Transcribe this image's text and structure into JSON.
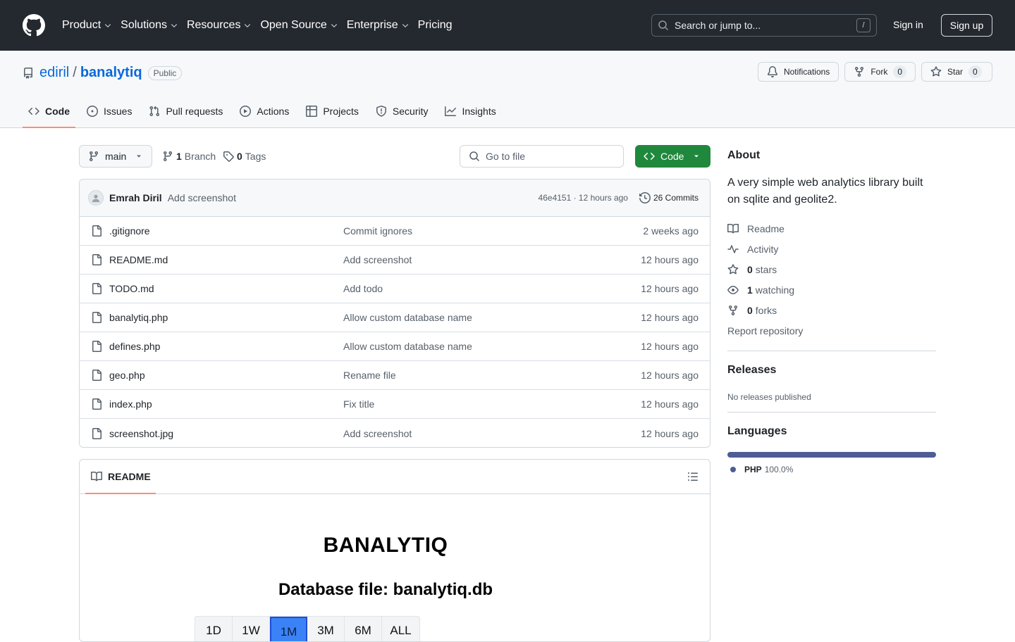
{
  "header": {
    "nav": [
      "Product",
      "Solutions",
      "Resources",
      "Open Source",
      "Enterprise",
      "Pricing"
    ],
    "search_placeholder": "Search or jump to...",
    "search_kbd": "/",
    "sign_in": "Sign in",
    "sign_up": "Sign up"
  },
  "repo": {
    "owner": "ediril",
    "separator": "/",
    "name": "banalytiq",
    "visibility": "Public",
    "actions": {
      "notifications": "Notifications",
      "fork": "Fork",
      "fork_count": "0",
      "star": "Star",
      "star_count": "0"
    },
    "tabs": [
      "Code",
      "Issues",
      "Pull requests",
      "Actions",
      "Projects",
      "Security",
      "Insights"
    ],
    "active_tab": "Code"
  },
  "toolbar": {
    "branch": "main",
    "branch_count": "1",
    "branch_label": "Branch",
    "tag_count": "0",
    "tag_label": "Tags",
    "go_to_file": "Go to file",
    "code_button": "Code"
  },
  "latest_commit": {
    "author": "Emrah Diril",
    "message": "Add screenshot",
    "hash_time": "46e4151 · 12 hours ago",
    "commits": "26 Commits"
  },
  "files": [
    {
      "name": ".gitignore",
      "message": "Commit ignores",
      "time": "2 weeks ago"
    },
    {
      "name": "README.md",
      "message": "Add screenshot",
      "time": "12 hours ago"
    },
    {
      "name": "TODO.md",
      "message": "Add todo",
      "time": "12 hours ago"
    },
    {
      "name": "banalytiq.php",
      "message": "Allow custom database name",
      "time": "12 hours ago"
    },
    {
      "name": "defines.php",
      "message": "Allow custom database name",
      "time": "12 hours ago"
    },
    {
      "name": "geo.php",
      "message": "Rename file",
      "time": "12 hours ago"
    },
    {
      "name": "index.php",
      "message": "Fix title",
      "time": "12 hours ago"
    },
    {
      "name": "screenshot.jpg",
      "message": "Add screenshot",
      "time": "12 hours ago"
    }
  ],
  "readme": {
    "tab_label": "README",
    "screenshot": {
      "title": "BANALYTIQ",
      "subtitle": "Database file: banalytiq.db",
      "ranges": [
        "1D",
        "1W",
        "1M",
        "3M",
        "6M",
        "ALL"
      ],
      "selected_range": "1M"
    }
  },
  "sidebar": {
    "about_title": "About",
    "description": "A very simple web analytics library built on sqlite and geolite2.",
    "links": {
      "readme": "Readme",
      "activity": "Activity",
      "stars_count": "0",
      "stars_label": "stars",
      "watching_count": "1",
      "watching_label": "watching",
      "forks_count": "0",
      "forks_label": "forks",
      "report": "Report repository"
    },
    "releases_title": "Releases",
    "releases_note": "No releases published",
    "languages_title": "Languages",
    "languages": [
      {
        "name": "PHP",
        "percent": "100.0%",
        "share": 1.0,
        "color": "#4F5D95"
      }
    ]
  }
}
